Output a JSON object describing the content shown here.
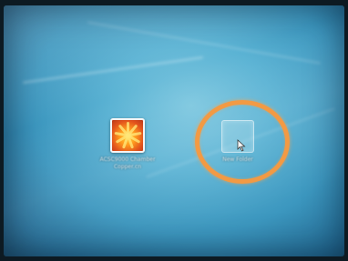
{
  "desktop": {
    "icons": [
      {
        "label": "ACSC9000 Chamber Copper.cn",
        "icon": "image-file-icon"
      },
      {
        "label": "New Folder",
        "icon": "folder-icon"
      }
    ],
    "highlight_color": "#f29a44",
    "wallpaper_color": "#5bb3d4"
  }
}
